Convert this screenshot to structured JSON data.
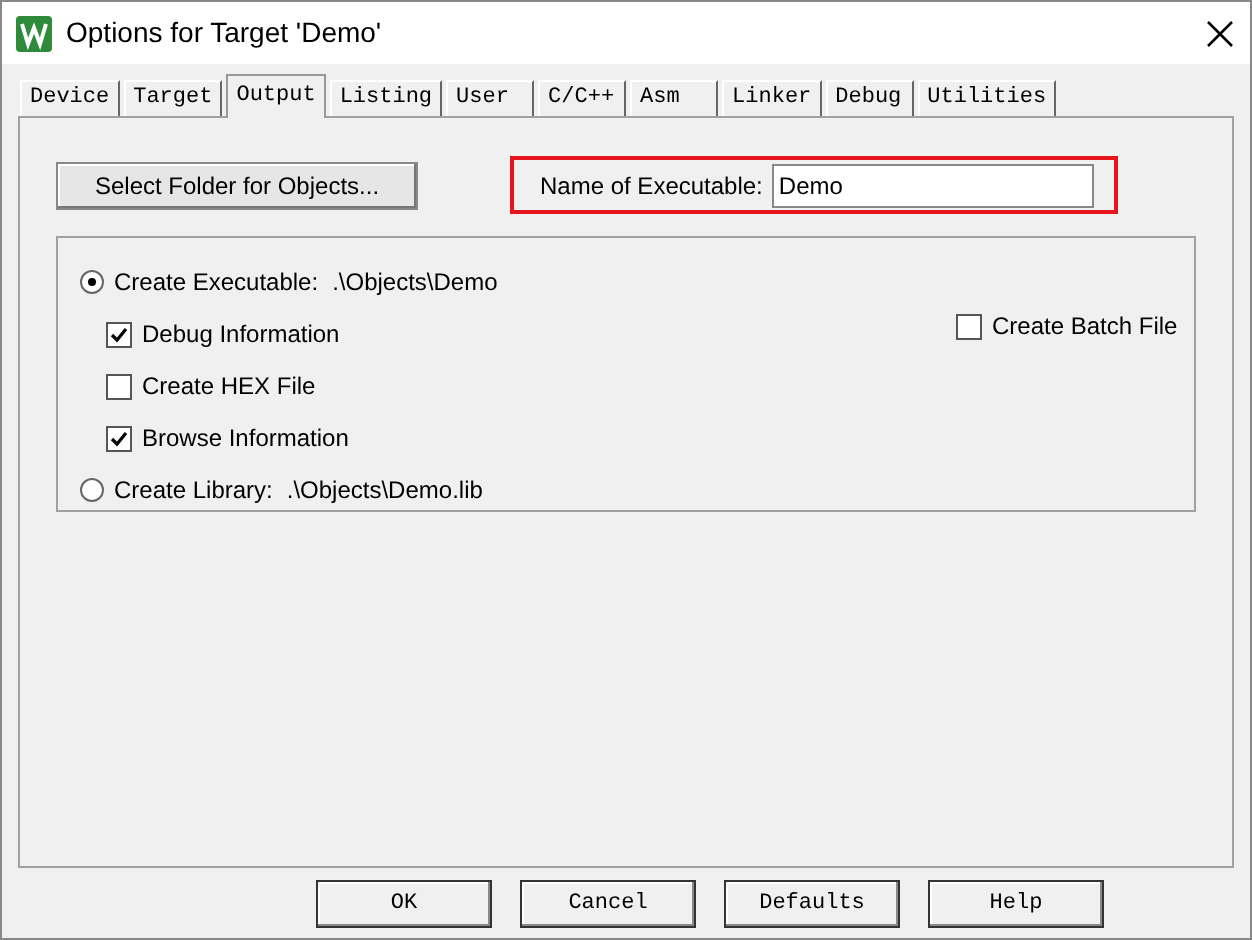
{
  "window": {
    "title": "Options for Target 'Demo'"
  },
  "tabs": [
    {
      "label": "Device",
      "selected": false
    },
    {
      "label": "Target",
      "selected": false
    },
    {
      "label": "Output",
      "selected": true
    },
    {
      "label": "Listing",
      "selected": false
    },
    {
      "label": "User",
      "selected": false
    },
    {
      "label": "C/C++",
      "selected": false
    },
    {
      "label": "Asm",
      "selected": false
    },
    {
      "label": "Linker",
      "selected": false
    },
    {
      "label": "Debug",
      "selected": false
    },
    {
      "label": "Utilities",
      "selected": false
    }
  ],
  "output": {
    "select_folder_button": "Select Folder for Objects...",
    "name_of_executable": {
      "label": "Name of Executable:",
      "value": "Demo",
      "highlighted": true
    },
    "create_batch_file": {
      "label": "Create Batch File",
      "checked": false
    },
    "output_types": [
      {
        "label": "Create Executable:",
        "path": ".\\Objects\\Demo",
        "selected": true,
        "children": [
          {
            "label": "Debug Information",
            "checked": true
          },
          {
            "label": "Create HEX File",
            "checked": false
          },
          {
            "label": "Browse Information",
            "checked": true
          }
        ]
      },
      {
        "label": "Create Library:",
        "path": ".\\Objects\\Demo.lib",
        "selected": false
      }
    ]
  },
  "buttons": [
    "OK",
    "Cancel",
    "Defaults",
    "Help"
  ]
}
